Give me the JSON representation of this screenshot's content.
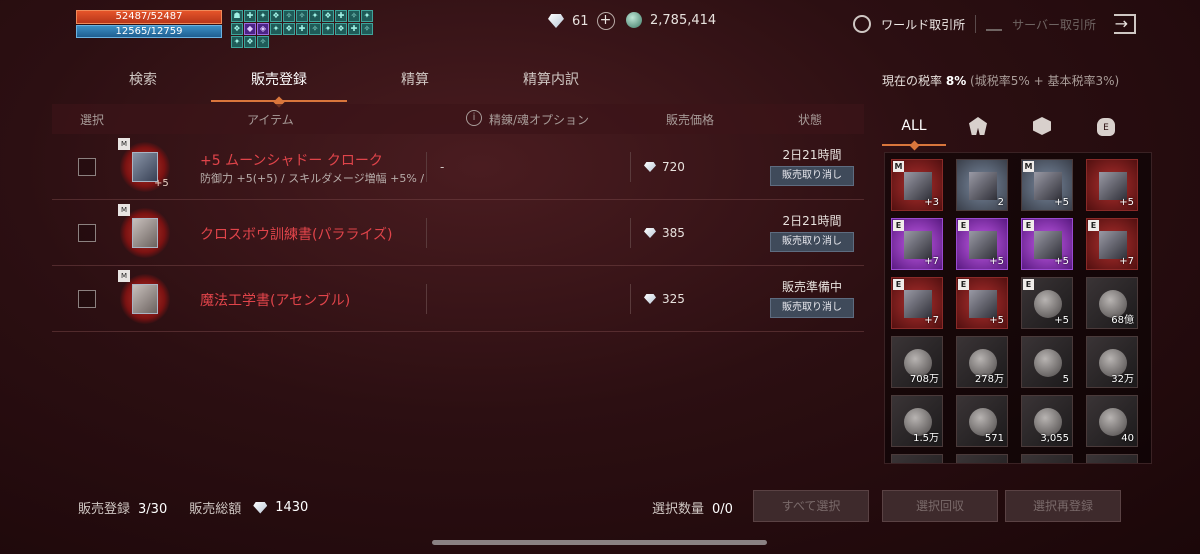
{
  "status": {
    "hp": "52487/52487",
    "mp": "12565/12759"
  },
  "buffs": [
    "☗",
    "✚",
    "✦",
    "❖",
    "✧",
    "✧",
    "✦",
    "❖",
    "✚",
    "✧",
    "✦",
    "❖",
    "◆",
    "◈",
    "✦",
    "❖",
    "✚",
    "✧",
    "✦",
    "❖",
    "✚",
    "✧",
    "✦",
    "❖",
    "✧"
  ],
  "currency": {
    "diamonds": "61",
    "coins": "2,785,414"
  },
  "top_right": {
    "world_exchange": "ワールド取引所",
    "server_exchange": "サーバー取引所"
  },
  "tabs": [
    "検索",
    "販売登録",
    "精算",
    "精算内訳"
  ],
  "tax": {
    "label": "現在の税率",
    "value": "8%",
    "detail": "(城税率5% + 基本税率3%)"
  },
  "table": {
    "headers": {
      "select": "選択",
      "item": "アイテム",
      "option": "精錬/魂オプション",
      "price": "販売価格",
      "state": "状態"
    },
    "rows": [
      {
        "name": "+5 ムーンシャドー クローク",
        "sub": "防御力 +5(+5) / スキルダメージ増幅 +5% /",
        "enhance": "+5",
        "option": "-",
        "price": "720",
        "status": "2日21時間",
        "cancel": "販売取り消し"
      },
      {
        "name": "クロスボウ訓練書(パラライズ)",
        "sub": "",
        "enhance": "",
        "option": "",
        "price": "385",
        "status": "2日21時間",
        "cancel": "販売取り消し"
      },
      {
        "name": "魔法工学書(アセンブル)",
        "sub": "",
        "enhance": "",
        "option": "",
        "price": "325",
        "status": "販売準備中",
        "cancel": "販売取り消し"
      }
    ]
  },
  "inventory": {
    "tabs": [
      "ALL"
    ],
    "slots": [
      {
        "qty": "+3",
        "badge": "M",
        "style": "red"
      },
      {
        "qty": "2",
        "badge": "",
        "style": "blue"
      },
      {
        "qty": "+5",
        "badge": "M",
        "style": "blue"
      },
      {
        "qty": "+5",
        "badge": "",
        "style": "red"
      },
      {
        "qty": "+7",
        "badge": "E",
        "style": "purple"
      },
      {
        "qty": "+5",
        "badge": "E",
        "style": "purple"
      },
      {
        "qty": "+5",
        "badge": "E",
        "style": "purple"
      },
      {
        "qty": "+7",
        "badge": "E",
        "style": "red"
      },
      {
        "qty": "+7",
        "badge": "E",
        "style": "red"
      },
      {
        "qty": "+5",
        "badge": "E",
        "style": "red"
      },
      {
        "qty": "+5",
        "badge": "E",
        "style": "dark"
      },
      {
        "qty": "68億",
        "badge": "",
        "style": "dark"
      },
      {
        "qty": "708万",
        "badge": "",
        "style": "dark"
      },
      {
        "qty": "278万",
        "badge": "",
        "style": "dark"
      },
      {
        "qty": "5",
        "badge": "",
        "style": "dark"
      },
      {
        "qty": "32万",
        "badge": "",
        "style": "dark"
      },
      {
        "qty": "1.5万",
        "badge": "",
        "style": "dark"
      },
      {
        "qty": "571",
        "badge": "",
        "style": "dark"
      },
      {
        "qty": "3,055",
        "badge": "",
        "style": "dark"
      },
      {
        "qty": "40",
        "badge": "",
        "style": "dark"
      }
    ]
  },
  "footer": {
    "registered_label": "販売登録",
    "registered_value": "3/30",
    "total_label": "販売総額",
    "total_value": "1430",
    "selected_label": "選択数量",
    "selected_value": "0/0",
    "select_all": "すべて選択",
    "recall": "選択回収",
    "reregister": "選択再登録"
  }
}
